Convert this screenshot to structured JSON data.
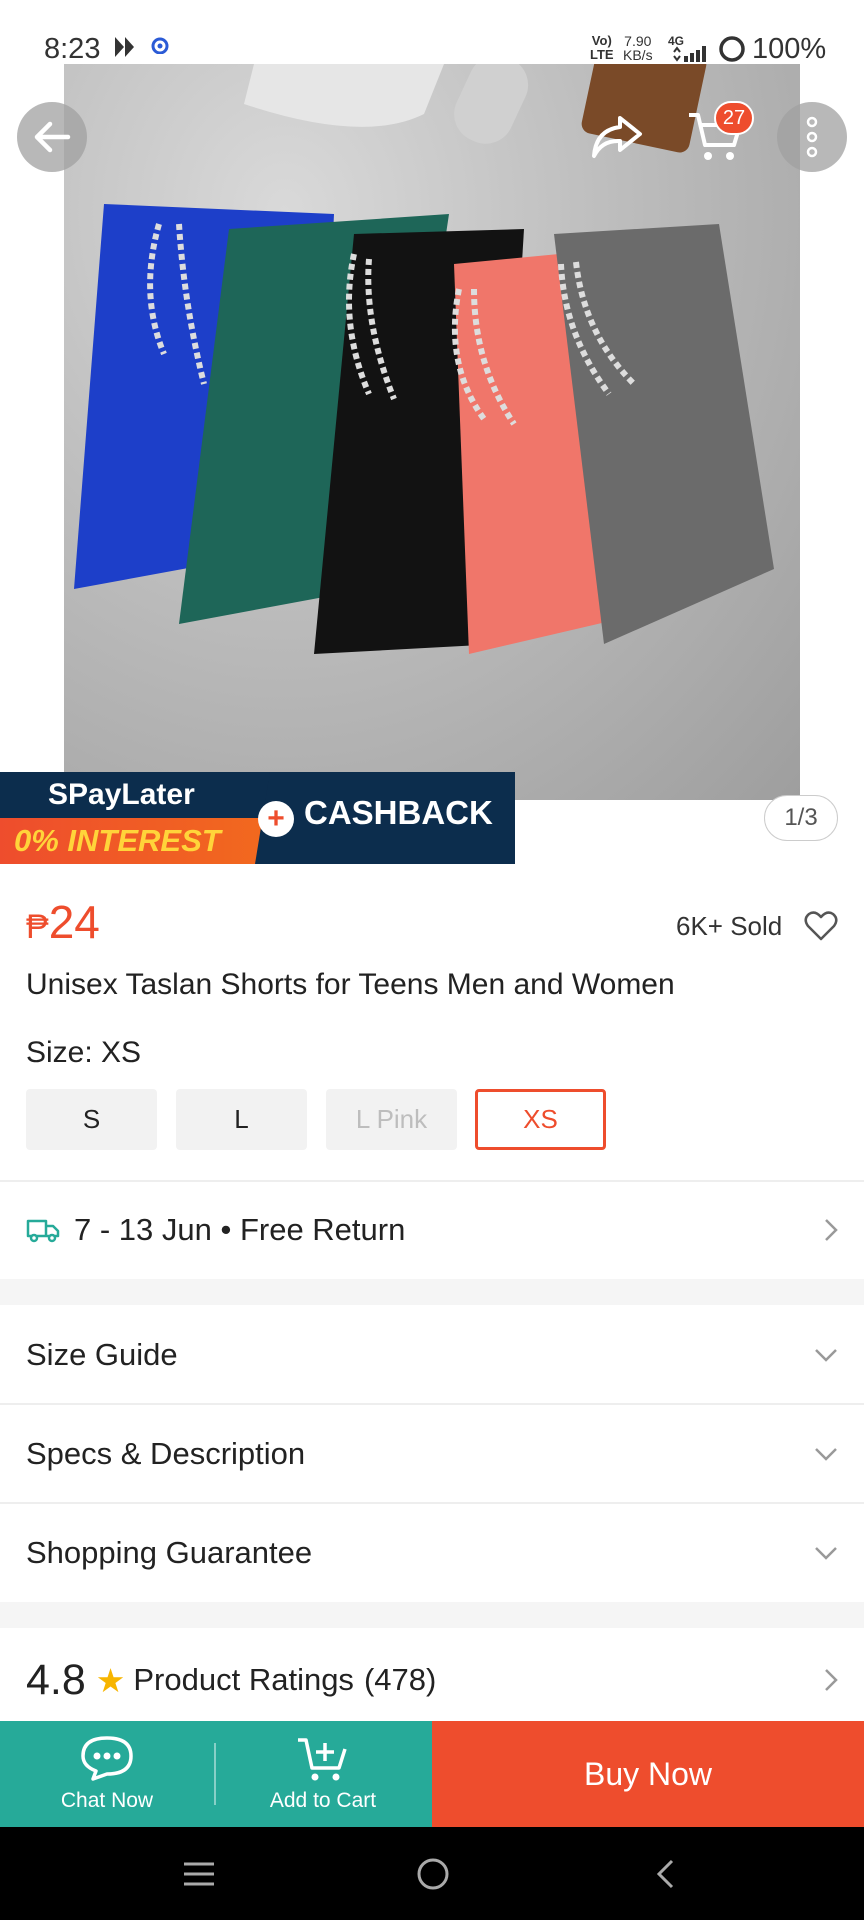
{
  "status_bar": {
    "time": "8:23",
    "network_top": "Vo)",
    "network_bottom": "LTE",
    "speed_value": "7.90",
    "speed_unit": "KB/s",
    "signal_type": "4G",
    "battery": "100%"
  },
  "header": {
    "back_icon": "arrow-left-icon",
    "share_icon": "share-icon",
    "cart_icon": "cart-icon",
    "cart_count": "27",
    "more_icon": "more-vertical-icon"
  },
  "gallery": {
    "pager": "1/3",
    "promo": {
      "line1": "SPayLater",
      "line2": "0% INTEREST",
      "cashback": "CASHBACK"
    }
  },
  "product": {
    "currency": "₱",
    "price": "24",
    "sold": "6K+ Sold",
    "title": "Unisex Taslan Shorts for Teens Men and Women",
    "size_label": "Size: XS",
    "sizes": [
      {
        "label": "S",
        "state": "normal"
      },
      {
        "label": "L",
        "state": "normal"
      },
      {
        "label": "L Pink",
        "state": "disabled"
      },
      {
        "label": "XS",
        "state": "selected"
      }
    ]
  },
  "delivery": {
    "text": "7 - 13 Jun • Free Return"
  },
  "sections": {
    "size_guide": "Size Guide",
    "specs": "Specs & Description",
    "guarantee": "Shopping Guarantee"
  },
  "ratings": {
    "score": "4.8",
    "label": "Product Ratings",
    "count": "(478)"
  },
  "actions": {
    "chat": "Chat Now",
    "add_to_cart": "Add to Cart",
    "buy_now": "Buy Now"
  },
  "colors": {
    "accent": "#ee4d2d",
    "green": "#26aa99",
    "star": "#f7b500"
  }
}
